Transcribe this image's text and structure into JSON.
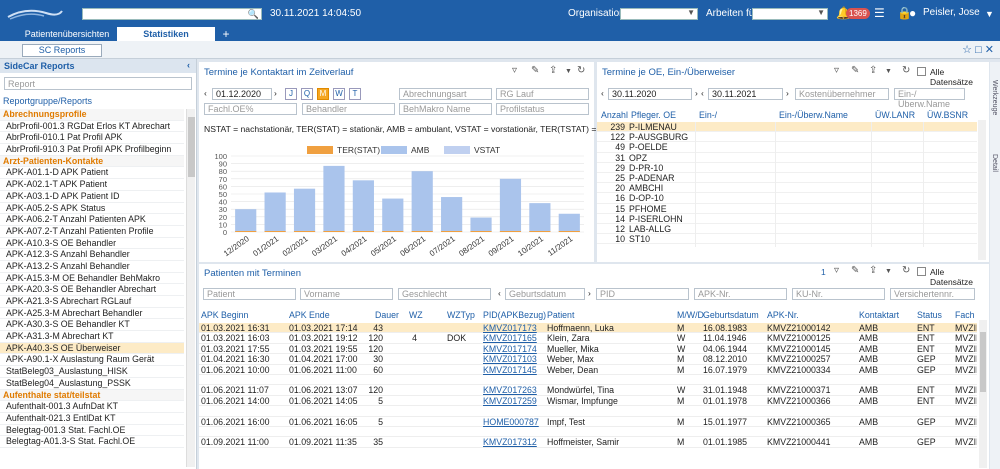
{
  "topbar": {
    "datetime": "30.11.2021 14:04:50",
    "org_label": "Organisation",
    "arbeit_label": "Arbeiten für",
    "badge": "1369",
    "user": "Peisler, Jose"
  },
  "tabs": [
    "Patientenübersichten",
    "Statistiken",
    "+"
  ],
  "subbar": {
    "button": "SC Reports"
  },
  "sidebar": {
    "title": "SideCar Reports",
    "search_placeholder": "Report",
    "link": "Reportgruppe/Reports",
    "rows": [
      {
        "t": "Abrechnungsprofile",
        "c": "cat"
      },
      {
        "t": "AbrProfil-001.3 RGDat Erlos KT Abrechart",
        "c": ""
      },
      {
        "t": "AbrProfil-010.1 Pat Profil APK",
        "c": ""
      },
      {
        "t": "AbrProfil-910.3 Pat Profil APK Profilbeginn",
        "c": ""
      },
      {
        "t": "Arzt-Patienten-Kontakte",
        "c": "cat"
      },
      {
        "t": "APK-A01.1-D APK Patient",
        "c": ""
      },
      {
        "t": "APK-A02.1-T APK Patient",
        "c": ""
      },
      {
        "t": "APK-A03.1-D APK Patient ID",
        "c": ""
      },
      {
        "t": "APK-A05.2-S APK Status",
        "c": ""
      },
      {
        "t": "APK-A06.2-T Anzahl Patienten APK",
        "c": ""
      },
      {
        "t": "APK-A07.2-T Anzahl Patienten Profile",
        "c": ""
      },
      {
        "t": "APK-A10.3-S OE Behandler",
        "c": ""
      },
      {
        "t": "APK-A12.3-S Anzahl Behandler",
        "c": ""
      },
      {
        "t": "APK-A13.2-S Anzahl Behandler",
        "c": ""
      },
      {
        "t": "APK-A15.3-M OE Behandler BehMakro",
        "c": ""
      },
      {
        "t": "APK-A20.3-S OE Behandler Abrechart",
        "c": ""
      },
      {
        "t": "APK-A21.3-S Abrechart RGLauf",
        "c": ""
      },
      {
        "t": "APK-A25.3-M Abrechart Behandler",
        "c": ""
      },
      {
        "t": "APK-A30.3-S OE Behandler KT",
        "c": ""
      },
      {
        "t": "APK-A31.3-M Abrechart KT",
        "c": ""
      },
      {
        "t": "APK-A40.3-S OE Überweiser",
        "c": "sel"
      },
      {
        "t": "APK-A90.1-X Auslastung Raum Gerät",
        "c": ""
      },
      {
        "t": "StatBeleg03_Auslastung_HISK",
        "c": ""
      },
      {
        "t": "StatBeleg04_Auslastung_PSSK",
        "c": ""
      },
      {
        "t": "Aufenthalte stat/teilstat",
        "c": "cat"
      },
      {
        "t": "Aufenthalt-001.3 AufnDat KT",
        "c": ""
      },
      {
        "t": "Aufenthalt-021.3 EntlDat KT",
        "c": ""
      },
      {
        "t": "Belegtag-001.3 Stat. Fachl.OE",
        "c": ""
      },
      {
        "t": "Belegtag-A01.3-S Stat. Fachl.OE",
        "c": ""
      }
    ]
  },
  "left_panel": {
    "title": "Termine je Kontaktart im Zeitverlauf",
    "date": "01.12.2020",
    "buttons": [
      "J",
      "Q",
      "M",
      "W",
      "T"
    ],
    "f_abrech": "Abrechnungsart",
    "f_rglauf": "RG Lauf",
    "f_fachl": "Fachl.OE%",
    "f_beh": "Behandler",
    "f_behm": "BehMakro Name",
    "f_prof": "Profilstatus",
    "legend_text": "NSTAT = nachstationär, TER(STAT) = stationär, AMB = ambulant, VSTAT = vorstationär, TER(TSTAT) ="
  },
  "chart_data": {
    "type": "bar",
    "categories": [
      "12/2020",
      "01/2021",
      "02/2021",
      "03/2021",
      "04/2021",
      "05/2021",
      "06/2021",
      "07/2021",
      "08/2021",
      "09/2021",
      "10/2021",
      "11/2021"
    ],
    "series": [
      {
        "name": "TER(STAT)",
        "color": "#f0a040",
        "values": [
          0,
          0,
          0,
          0,
          0,
          0,
          0,
          0,
          0,
          0,
          0,
          0
        ]
      },
      {
        "name": "AMB",
        "color": "#aac4ec",
        "values": [
          30,
          52,
          57,
          87,
          68,
          44,
          80,
          46,
          19,
          70,
          38,
          24
        ]
      },
      {
        "name": "VSTAT",
        "color": "#c0d0f0",
        "values": [
          0,
          0,
          0,
          0,
          0,
          0,
          0,
          0,
          0,
          0,
          0,
          0
        ]
      }
    ],
    "yticks": [
      0,
      10,
      20,
      30,
      40,
      50,
      60,
      70,
      80,
      90,
      100
    ],
    "ylim": [
      0,
      100
    ],
    "grid": true
  },
  "right_panel": {
    "title": "Termine je OE, Ein-/Überweiser",
    "alle": "Alle Datensätze",
    "d1": "30.11.2020",
    "d2": "30.11.2021",
    "f_kost": "Kostenübernehmer",
    "f_einue": "Ein-/Überw.Name",
    "headers": [
      "Anzahl",
      "Pfleger. OE",
      "Ein-/",
      "Ein-/Überw.Name",
      "ÜW.LANR",
      "ÜW.BSNR"
    ],
    "rows": [
      [
        "239",
        "P-ILMENAU"
      ],
      [
        "122",
        "P-AUSGBURG"
      ],
      [
        "49",
        "P-OELDE"
      ],
      [
        "31",
        "OPZ"
      ],
      [
        "29",
        "D-PR-10"
      ],
      [
        "25",
        "P-ADENAR"
      ],
      [
        "20",
        "AMBCHI"
      ],
      [
        "16",
        "D-OP-10"
      ],
      [
        "15",
        "PFHOME"
      ],
      [
        "14",
        "P-ISERLOHN"
      ],
      [
        "12",
        "LAB-ALLG"
      ],
      [
        "10",
        "ST10"
      ]
    ]
  },
  "bottom_panel": {
    "title": "Patienten mit Terminen",
    "count": "1",
    "alle": "Alle Datensätze",
    "filters": [
      "Patient",
      "Vorname",
      "Geschlecht",
      "Geburtsdatum",
      "PID",
      "APK-Nr.",
      "KU-Nr.",
      "Versichertennr."
    ],
    "headers": [
      "APK Beginn",
      "APK Ende",
      "Dauer",
      "WZ",
      "WZTyp",
      "PID(APKBezug)",
      "Patient",
      "M/W/D",
      "Geburtsdatum",
      "APK-Nr.",
      "Kontaktart",
      "Status",
      "Fach"
    ],
    "rows": [
      [
        "01.03.2021 16:31",
        "01.03.2021 17:14",
        "43",
        "",
        "",
        "KMVZ017173",
        "Hoffmaenn, Luka",
        "M",
        "16.08.1983",
        "KMVZ21000142",
        "AMB",
        "ENT",
        "MVZII"
      ],
      [
        "01.03.2021 16:03",
        "01.03.2021 19:12",
        "120",
        "4",
        "DOK",
        "KMVZ017165",
        "Klein, Zara",
        "W",
        "11.04.1946",
        "KMVZ21000125",
        "AMB",
        "ENT",
        "MVZII"
      ],
      [
        "01.03.2021 17:55",
        "01.03.2021 19:55",
        "120",
        "",
        "",
        "KMVZ017174",
        "Mueller, Mika",
        "W",
        "04.06.1944",
        "KMVZ21000145",
        "AMB",
        "ENT",
        "MVZII"
      ],
      [
        "01.04.2021 16:30",
        "01.04.2021 17:00",
        "30",
        "",
        "",
        "KMVZ017103",
        "Weber, Max",
        "M",
        "08.12.2010",
        "KMVZ21000257",
        "AMB",
        "GEP",
        "MVZII"
      ],
      [
        "01.06.2021 10:00",
        "01.06.2021 11:00",
        "60",
        "",
        "",
        "KMVZ017145",
        "Weber, Dean",
        "M",
        "16.07.1979",
        "KMVZ21000334",
        "AMB",
        "GEP",
        "MVZII"
      ],
      [
        "",
        "",
        "",
        "",
        "",
        "",
        "",
        "",
        "",
        "",
        "",
        "",
        ""
      ],
      [
        "01.06.2021 11:07",
        "01.06.2021 13:07",
        "120",
        "",
        "",
        "KMVZ017263",
        "Mondwürfel, Tina",
        "W",
        "31.01.1948",
        "KMVZ21000371",
        "AMB",
        "ENT",
        "MVZII"
      ],
      [
        "01.06.2021 14:00",
        "01.06.2021 14:05",
        "5",
        "",
        "",
        "KMVZ017259",
        "Wismar, Impfunge",
        "M",
        "01.01.1978",
        "KMVZ21000366",
        "AMB",
        "ENT",
        "MVZII"
      ],
      [
        "",
        "",
        "",
        "",
        "",
        "",
        "",
        "",
        "",
        "",
        "",
        "",
        ""
      ],
      [
        "01.06.2021 16:00",
        "01.06.2021 16:05",
        "5",
        "",
        "",
        "HOME000787",
        "Impf, Test",
        "M",
        "15.01.1977",
        "KMVZ21000365",
        "AMB",
        "GEP",
        "MVZII"
      ],
      [
        "",
        "",
        "",
        "",
        "",
        "",
        "",
        "",
        "",
        "",
        "",
        "",
        ""
      ],
      [
        "01.09.2021 11:00",
        "01.09.2021 11:35",
        "35",
        "",
        "",
        "KMVZ017312",
        "Hoffmeister, Samir",
        "M",
        "01.01.1985",
        "KMVZ21000441",
        "AMB",
        "GEP",
        "MVZII"
      ]
    ]
  },
  "right_strip": [
    "Werkzeuge",
    "Detail"
  ]
}
